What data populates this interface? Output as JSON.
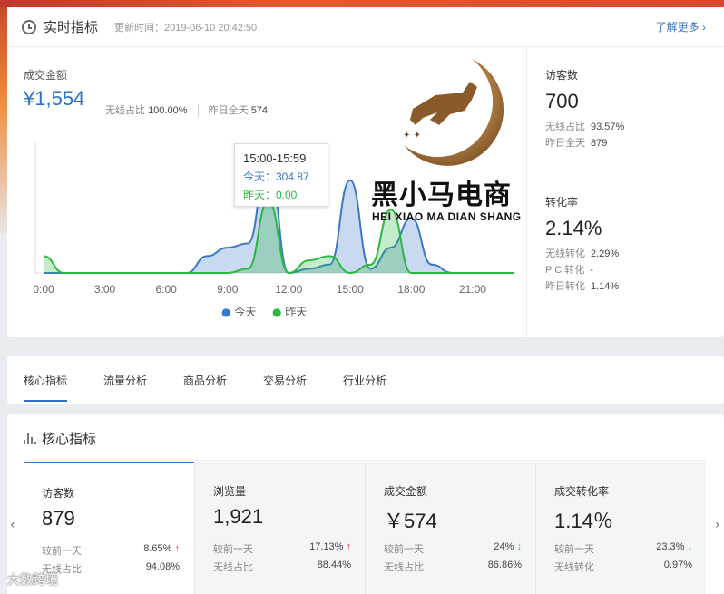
{
  "realtime": {
    "title": "实时指标",
    "update_time": "更新时间：2019-06-10 20:42:50",
    "more_link": "了解更多 ›",
    "amount_label": "成交金额",
    "amount_value": "¥1,554",
    "wireless_label": "无线占比",
    "wireless_value": "100.00%",
    "yesterday_label": "昨日全天",
    "yesterday_value": "574",
    "tooltip": {
      "time": "15:00-15:59",
      "today": "今天：304.87",
      "yesterday": "昨天：0.00"
    },
    "legend": {
      "today": "今天",
      "yesterday": "昨天"
    },
    "visitors": {
      "label": "访客数",
      "value": "700",
      "rows": [
        {
          "label": "无线占比",
          "value": "93.57%"
        },
        {
          "label": "昨日全天",
          "value": "879"
        }
      ]
    },
    "conversion": {
      "label": "转化率",
      "value": "2.14%",
      "rows": [
        {
          "label": "无线转化",
          "value": "2.29%"
        },
        {
          "label": "P C 转化",
          "value": "-"
        },
        {
          "label": "昨日转化",
          "value": "1.14%"
        }
      ]
    }
  },
  "watermark": {
    "brand": "黑小马电商",
    "sub": "HEI XIAO MA DIAN SHANG"
  },
  "chart_data": {
    "type": "area",
    "categories": [
      "0:00",
      "3:00",
      "6:00",
      "9:00",
      "12:00",
      "15:00",
      "18:00",
      "21:00"
    ],
    "x": [
      0,
      1,
      2,
      3,
      4,
      5,
      6,
      7,
      8,
      9,
      10,
      11,
      12,
      13,
      14,
      15,
      16,
      17,
      18,
      19,
      20,
      21,
      22,
      23
    ],
    "series": [
      {
        "name": "今天",
        "color": "#3a78c9",
        "values": [
          0,
          0,
          0,
          0,
          0,
          0,
          0,
          0,
          40,
          60,
          70,
          270,
          0,
          10,
          20,
          220,
          10,
          60,
          130,
          20,
          0,
          null,
          null,
          null
        ]
      },
      {
        "name": "昨天",
        "color": "#2bb841",
        "values": [
          40,
          0,
          0,
          0,
          0,
          0,
          0,
          0,
          0,
          0,
          10,
          170,
          0,
          30,
          40,
          0,
          20,
          150,
          0,
          0,
          0,
          0,
          0,
          0
        ]
      }
    ],
    "ylim": [
      0,
      310
    ]
  },
  "tabs": [
    "核心指标",
    "流量分析",
    "商品分析",
    "交易分析",
    "行业分析"
  ],
  "core": {
    "title": "核心指标",
    "cards": [
      {
        "label": "访客数",
        "value": "879",
        "row1_label": "较前一天",
        "row1_value": "8.65%",
        "row1_dir": "up",
        "row2_label": "无线占比",
        "row2_value": "94.08%"
      },
      {
        "label": "浏览量",
        "value": "1,921",
        "row1_label": "较前一天",
        "row1_value": "17.13%",
        "row1_dir": "up",
        "row2_label": "无线占比",
        "row2_value": "88.44%"
      },
      {
        "label": "成交金额",
        "value": "￥574",
        "row1_label": "较前一天",
        "row1_value": "24%",
        "row1_dir": "down",
        "row2_label": "无线占比",
        "row2_value": "86.86%"
      },
      {
        "label": "成交转化率",
        "value": "1.14％",
        "row1_label": "较前一天",
        "row1_value": "23.3%",
        "row1_dir": "down",
        "row2_label": "无线转化",
        "row2_value": "0.97%"
      }
    ],
    "arrows": {
      "up": "↑",
      "down": "↓",
      "prev": "‹",
      "next": "›"
    }
  },
  "footer_logo": "大数跨境"
}
